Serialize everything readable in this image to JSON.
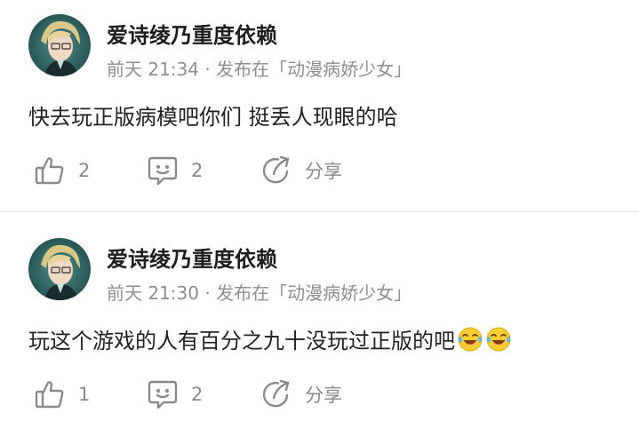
{
  "posts": [
    {
      "username": "爱诗绫乃重度依赖",
      "meta": "前天 21:34 · 发布在「动漫病娇少女」",
      "text": "快去玩正版病模吧你们 挺丢人现眼的哈",
      "emojis": [],
      "likes": "2",
      "comments": "2",
      "share_label": "分享"
    },
    {
      "username": "爱诗绫乃重度依赖",
      "meta": "前天 21:30 · 发布在「动漫病娇少女」",
      "text": "玩这个游戏的人有百分之九十没玩过正版的吧",
      "emojis": [
        "laughing-crying-emoji",
        "laughing-crying-emoji"
      ],
      "likes": "1",
      "comments": "2",
      "share_label": "分享"
    }
  ],
  "icons": {
    "like": "thumbs-up-icon",
    "comment": "comment-icon",
    "share": "share-icon"
  },
  "colors": {
    "text": "#222222",
    "muted": "#8e8e8e",
    "icon": "#8a8a8a",
    "divider": "#e6e6e6"
  }
}
